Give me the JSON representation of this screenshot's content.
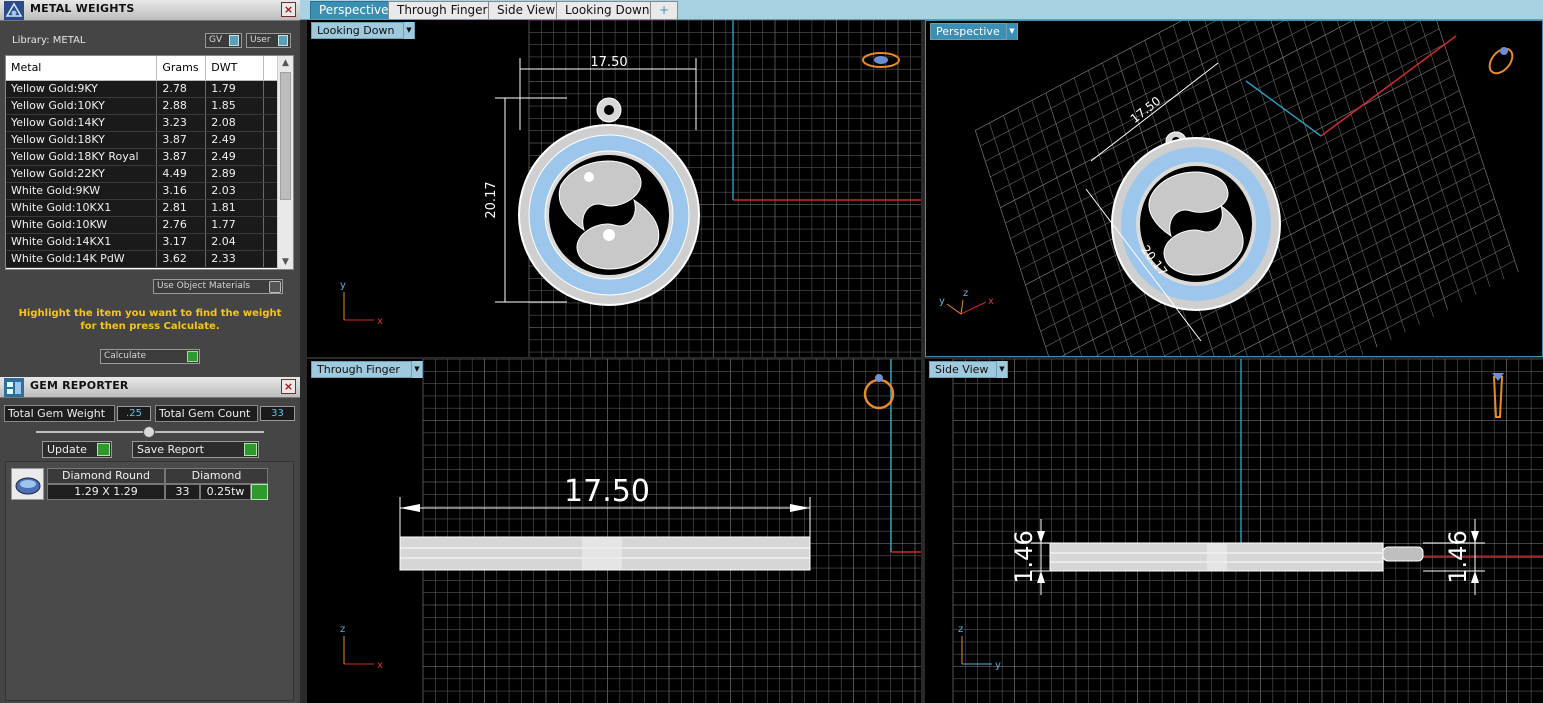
{
  "metal_weights": {
    "title": "METAL WEIGHTS",
    "library_label": "Library: METAL",
    "gv_label": "GV",
    "user_label": "User",
    "columns": [
      "Metal",
      "Grams",
      "DWT"
    ],
    "rows": [
      {
        "metal": "Yellow Gold:9KY",
        "grams": "2.78",
        "dwt": "1.79"
      },
      {
        "metal": "Yellow Gold:10KY",
        "grams": "2.88",
        "dwt": "1.85"
      },
      {
        "metal": "Yellow Gold:14KY",
        "grams": "3.23",
        "dwt": "2.08"
      },
      {
        "metal": "Yellow Gold:18KY",
        "grams": "3.87",
        "dwt": "2.49"
      },
      {
        "metal": "Yellow Gold:18KY Royal",
        "grams": "3.87",
        "dwt": "2.49"
      },
      {
        "metal": "Yellow Gold:22KY",
        "grams": "4.49",
        "dwt": "2.89"
      },
      {
        "metal": "White Gold:9KW",
        "grams": "3.16",
        "dwt": "2.03"
      },
      {
        "metal": "White Gold:10KX1",
        "grams": "2.81",
        "dwt": "1.81"
      },
      {
        "metal": "White Gold:10KW",
        "grams": "2.76",
        "dwt": "1.77"
      },
      {
        "metal": "White Gold:14KX1",
        "grams": "3.17",
        "dwt": "2.04"
      },
      {
        "metal": "White Gold:14K PdW",
        "grams": "3.62",
        "dwt": "2.33"
      }
    ],
    "use_object_materials": "Use Object Materials",
    "hint": "Highlight the item you want to find the weight for then press Calculate.",
    "calculate": "Calculate"
  },
  "gem_reporter": {
    "title": "GEM REPORTER",
    "total_weight_label": "Total Gem Weight",
    "total_weight_value": ".25",
    "total_count_label": "Total Gem Count",
    "total_count_value": "33",
    "update": "Update",
    "save_report": "Save Report",
    "gem": {
      "shape": "Diamond Round",
      "type": "Diamond",
      "size": "1.29 X 1.29",
      "count": "33",
      "weight": "0.25tw"
    }
  },
  "tabs": [
    "Perspective",
    "Through Finger",
    "Side View",
    "Looking Down",
    "+"
  ],
  "active_tab": 0,
  "viewports": {
    "top_left": {
      "label": "Looking Down",
      "dim_width": "17.50",
      "dim_height": "20.17"
    },
    "top_right": {
      "label": "Perspective",
      "dim_width": "17.50",
      "dim_height": "20.17"
    },
    "bottom_left": {
      "label": "Through Finger",
      "dim_width": "17.50"
    },
    "bottom_right": {
      "label": "Side View",
      "dim_thickness_left": "1.46",
      "dim_thickness_right": "1.46"
    }
  },
  "axes": {
    "x": "x",
    "y": "y",
    "z": "z"
  },
  "colors": {
    "active_tab": "#3b8fb3",
    "tab_bar": "#a8d1e1",
    "accent_cyan": "#2aa0c0",
    "axis_red": "#cc2a2a",
    "hint_yellow": "#f5c518",
    "gem_blue": "#9cc6ec"
  }
}
